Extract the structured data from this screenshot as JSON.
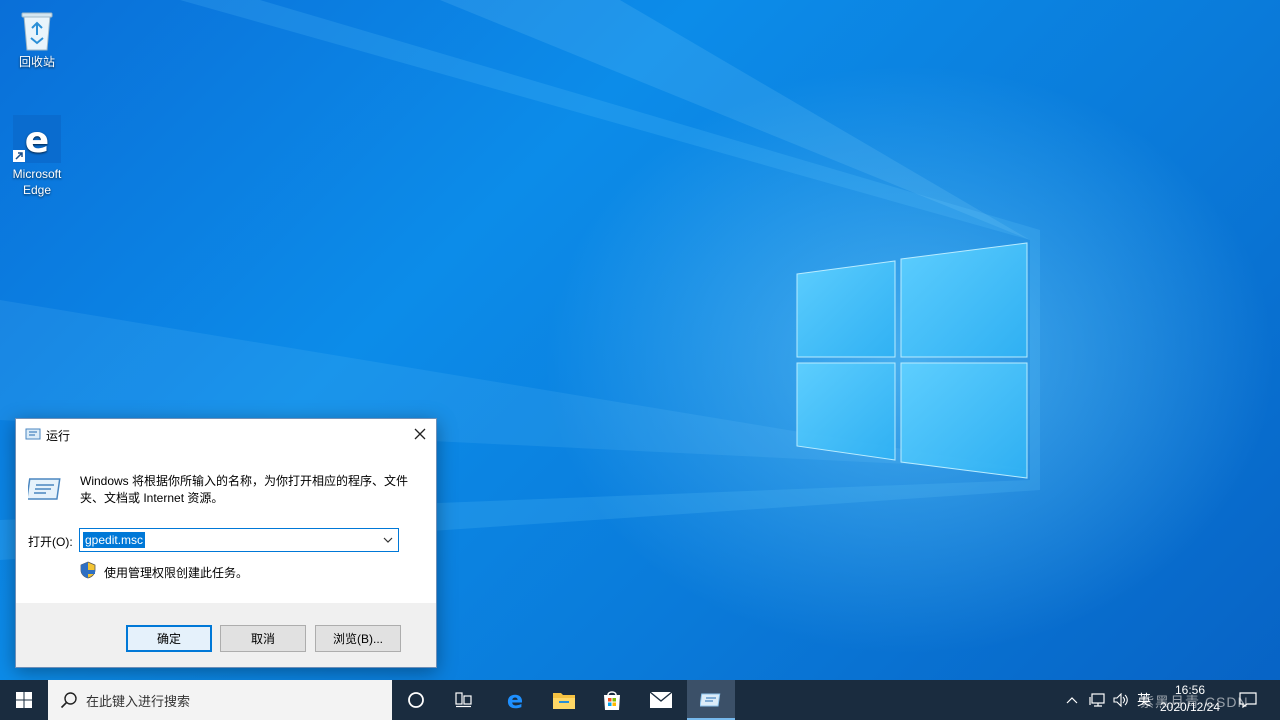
{
  "desktop": {
    "recycle_bin_label": "回收站",
    "edge_label_line1": "Microsoft",
    "edge_label_line2": "Edge"
  },
  "run_dialog": {
    "title": "运行",
    "description": "Windows 将根据你所输入的名称，为你打开相应的程序、文件夹、文档或 Internet 资源。",
    "open_label": "打开(O):",
    "input_value": "gpedit.msc",
    "admin_text": "使用管理权限创建此任务。",
    "ok_label": "确定",
    "cancel_label": "取消",
    "browse_label": "浏览(B)..."
  },
  "taskbar": {
    "search_placeholder": "在此键入进行搜索",
    "ime_label": "英",
    "time": "16:56",
    "date": "2020/12/24",
    "watermark": "紫黑月青 CSDN"
  },
  "colors": {
    "accent": "#0078d7",
    "taskbar_bg": "#1a2c3f",
    "desktop_blue": "#0a7ad9"
  },
  "icons": [
    "recycle-bin-icon",
    "edge-icon",
    "run-icon",
    "close-icon",
    "chevron-down-icon",
    "uac-shield-icon",
    "windows-start-icon",
    "search-icon",
    "cortana-icon",
    "task-view-icon",
    "file-explorer-icon",
    "store-icon",
    "mail-icon",
    "chevron-up-icon",
    "network-icon",
    "volume-icon",
    "notification-icon"
  ]
}
